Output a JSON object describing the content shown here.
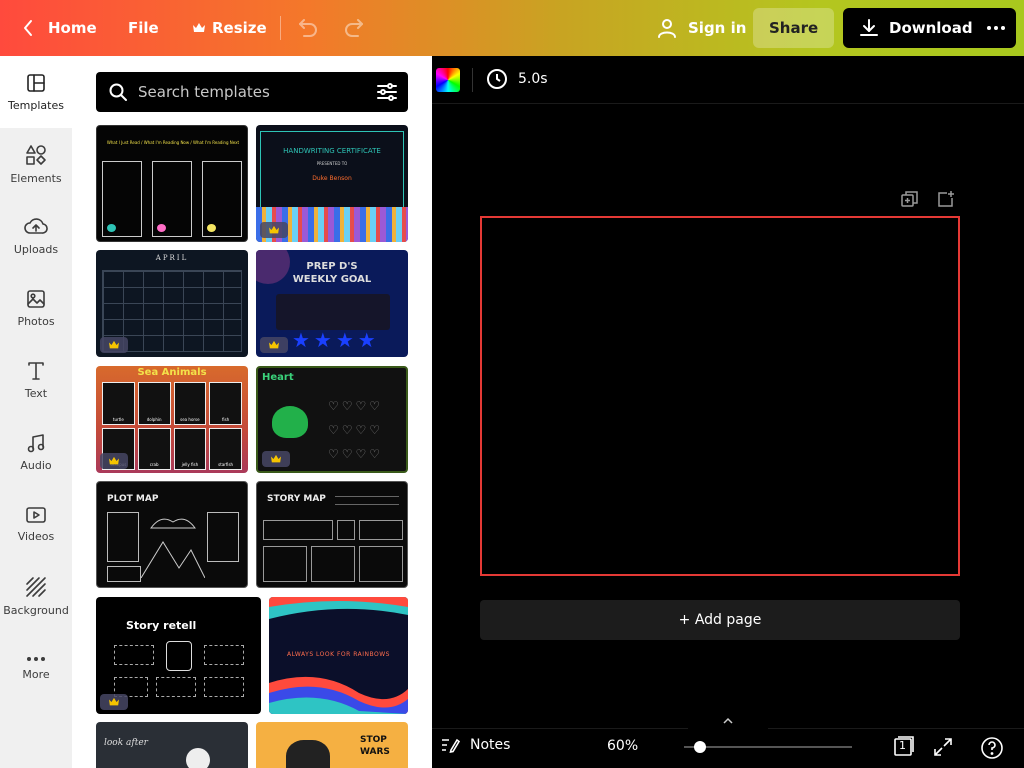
{
  "topbar": {
    "home_label": "Home",
    "file_label": "File",
    "resize_label": "Resize",
    "signin_label": "Sign in",
    "share_label": "Share",
    "download_label": "Download"
  },
  "rail": {
    "items": [
      {
        "label": "Templates",
        "icon": "templates-icon"
      },
      {
        "label": "Elements",
        "icon": "elements-icon"
      },
      {
        "label": "Uploads",
        "icon": "uploads-icon"
      },
      {
        "label": "Photos",
        "icon": "photos-icon"
      },
      {
        "label": "Text",
        "icon": "text-icon"
      },
      {
        "label": "Audio",
        "icon": "audio-icon"
      },
      {
        "label": "Videos",
        "icon": "videos-icon"
      },
      {
        "label": "Background",
        "icon": "background-icon"
      },
      {
        "label": "More",
        "icon": "more-icon"
      }
    ]
  },
  "panel": {
    "search_placeholder": "Search templates",
    "templates": [
      {
        "title": "What I Just Read / What I'm Reading Now / What I'm Reading Next",
        "premium": false
      },
      {
        "title": "HANDWRITING CERTIFICATE",
        "subtitle": "PRESENTED TO",
        "name": "Duke Benson",
        "premium": true
      },
      {
        "title": "APRIL",
        "premium": true
      },
      {
        "title": "PREP D'S WEEKLY GOAL",
        "premium": true
      },
      {
        "title": "Sea Animals",
        "labels": [
          "turtle",
          "dolphin",
          "sea horse",
          "fish",
          "octopus",
          "crab",
          "jelly fish",
          "starfish"
        ],
        "premium": true
      },
      {
        "title": "Heart",
        "premium": true
      },
      {
        "title": "PLOT MAP",
        "premium": false
      },
      {
        "title": "STORY MAP",
        "premium": false
      },
      {
        "title": "Story retell",
        "premium": true
      },
      {
        "title": "ALWAYS LOOK FOR RAINBOWS",
        "premium": false
      },
      {
        "title": "look after",
        "premium": false
      },
      {
        "title": "STOP WARS",
        "premium": false
      }
    ]
  },
  "canvas_toolbar": {
    "duration": "5.0s"
  },
  "stage": {
    "add_page_label": "+ Add page"
  },
  "footer": {
    "notes_label": "Notes",
    "zoom": "60%",
    "page_count": "1"
  },
  "colors": {
    "topbar_gradient": [
      "#ff4a3d",
      "#f4782a",
      "#c8a422",
      "#a8c81e"
    ],
    "selection_border": "#e53935",
    "crown": "#f5c400"
  }
}
